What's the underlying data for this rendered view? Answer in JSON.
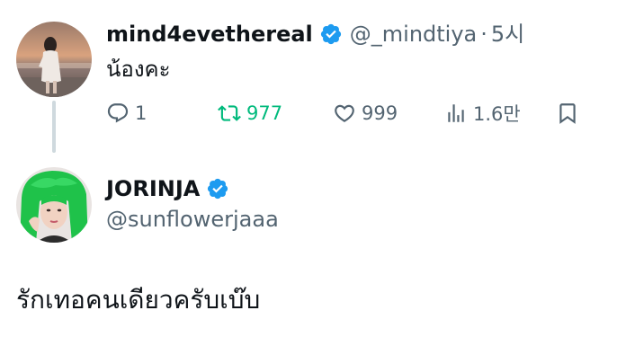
{
  "tweet_reply": {
    "display_name": "mind4evethereal",
    "handle": "@_mindtiya",
    "separator": "·",
    "time": "5시",
    "text": "น้องคะ",
    "actions": {
      "replies": "1",
      "retweets": "977",
      "likes": "999",
      "views": "1.6만"
    }
  },
  "tweet_main": {
    "display_name": "JORINJA",
    "handle": "@sunflowerjaaa",
    "text": "รักเทอคนเดียวครับเบ๊บ"
  },
  "icons": {
    "verified": "verified-badge-icon",
    "reply": "reply-icon",
    "retweet": "retweet-icon",
    "like": "heart-icon",
    "views": "views-chart-icon",
    "bookmark": "bookmark-icon"
  },
  "colors": {
    "verified": "#1d9bf0",
    "retweet_active": "#00ba7c",
    "secondary_text": "#536471",
    "primary_text": "#0f1419",
    "thread_line": "#cfd9de"
  }
}
